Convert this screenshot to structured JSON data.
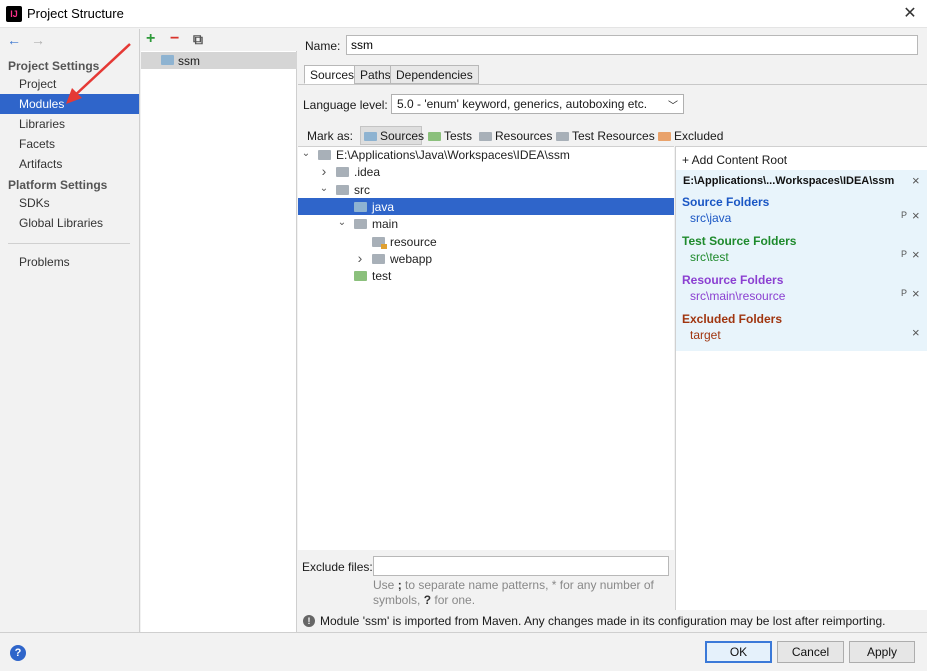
{
  "window": {
    "title": "Project Structure",
    "app_icon_text": "IJ"
  },
  "nav": {
    "back": "←",
    "forward": "→",
    "project_settings_header": "Project Settings",
    "project_settings_items": [
      "Project",
      "Modules",
      "Libraries",
      "Facets",
      "Artifacts"
    ],
    "platform_settings_header": "Platform Settings",
    "platform_settings_items": [
      "SDKs",
      "Global Libraries"
    ],
    "problems": "Problems",
    "selected": "Modules"
  },
  "module_list": {
    "add": "+",
    "remove": "−",
    "copy": "⧉",
    "items": [
      "ssm"
    ]
  },
  "module": {
    "name_label": "Name:",
    "name_value": "ssm",
    "tabs": [
      "Sources",
      "Paths",
      "Dependencies"
    ],
    "active_tab": "Sources",
    "language_level_label": "Language level:",
    "language_level_value": "5.0 - 'enum' keyword, generics, autoboxing etc.",
    "mark_as_label": "Mark as:",
    "mark_as": [
      {
        "label": "Sources",
        "color": "#8eb3d1"
      },
      {
        "label": "Tests",
        "color": "#8bc07c"
      },
      {
        "label": "Resources",
        "color": "#a8b0b8"
      },
      {
        "label": "Test Resources",
        "color": "#a8b0b8"
      },
      {
        "label": "Excluded",
        "color": "#e9a26b"
      }
    ],
    "tree": [
      {
        "label": "E:\\Applications\\Java\\Workspaces\\IDEA\\ssm",
        "arrow": "down",
        "kind": "plain"
      },
      {
        "label": ".idea",
        "arrow": "right",
        "kind": "plain"
      },
      {
        "label": "src",
        "arrow": "down",
        "kind": "plain"
      },
      {
        "label": "java",
        "arrow": "",
        "kind": "src",
        "selected": true
      },
      {
        "label": "main",
        "arrow": "down",
        "kind": "plain"
      },
      {
        "label": "resource",
        "arrow": "",
        "kind": "res"
      },
      {
        "label": "webapp",
        "arrow": "right",
        "kind": "plain"
      },
      {
        "label": "test",
        "arrow": "",
        "kind": "test"
      }
    ],
    "exclude_label": "Exclude files:",
    "exclude_value": "",
    "exclude_hint_prefix": "Use ",
    "exclude_hint_semicolon": ";",
    "exclude_hint_middle": " to separate name patterns, * for any number of symbols, ",
    "exclude_hint_q": "?",
    "exclude_hint_suffix": " for one.",
    "info_icon": "!",
    "info_text": "Module 'ssm' is imported from Maven. Any changes made in its configuration may be lost after reimporting."
  },
  "content_roots": {
    "add_label": "+ Add Content Root",
    "root_path": "E:\\Applications\\...Workspaces\\IDEA\\ssm",
    "close": "×",
    "edit_props": "P",
    "groups": [
      {
        "title": "Source Folders",
        "item": "src\\java",
        "color": "#1a56c4",
        "has_props": true
      },
      {
        "title": "Test Source Folders",
        "item": "src\\test",
        "color": "#1e8a2c",
        "has_props": true
      },
      {
        "title": "Resource Folders",
        "item": "src\\main\\resource",
        "color": "#8b3fd1",
        "has_props": true
      },
      {
        "title": "Excluded Folders",
        "item": "target",
        "color": "#a0350f",
        "has_props": false
      }
    ]
  },
  "buttons": {
    "ok": "OK",
    "cancel": "Cancel",
    "apply": "Apply",
    "help": "?"
  }
}
